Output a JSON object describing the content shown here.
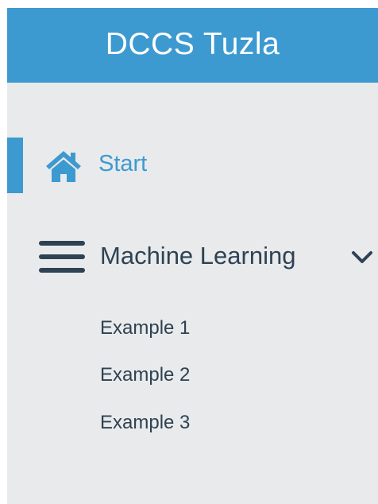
{
  "header": {
    "title": "DCCS Tuzla"
  },
  "nav": {
    "start": {
      "label": "Start",
      "icon": "home-icon",
      "active": true
    },
    "machine_learning": {
      "label": "Machine Learning",
      "icon": "menu-icon",
      "expanded": true,
      "toggle_icon": "chevron-down-icon",
      "items": [
        {
          "label": "Example 1"
        },
        {
          "label": "Example 2"
        },
        {
          "label": "Example 3"
        }
      ]
    }
  },
  "colors": {
    "accent": "#3d9ad1",
    "background": "#e9eaeb",
    "text": "#2e4254"
  }
}
